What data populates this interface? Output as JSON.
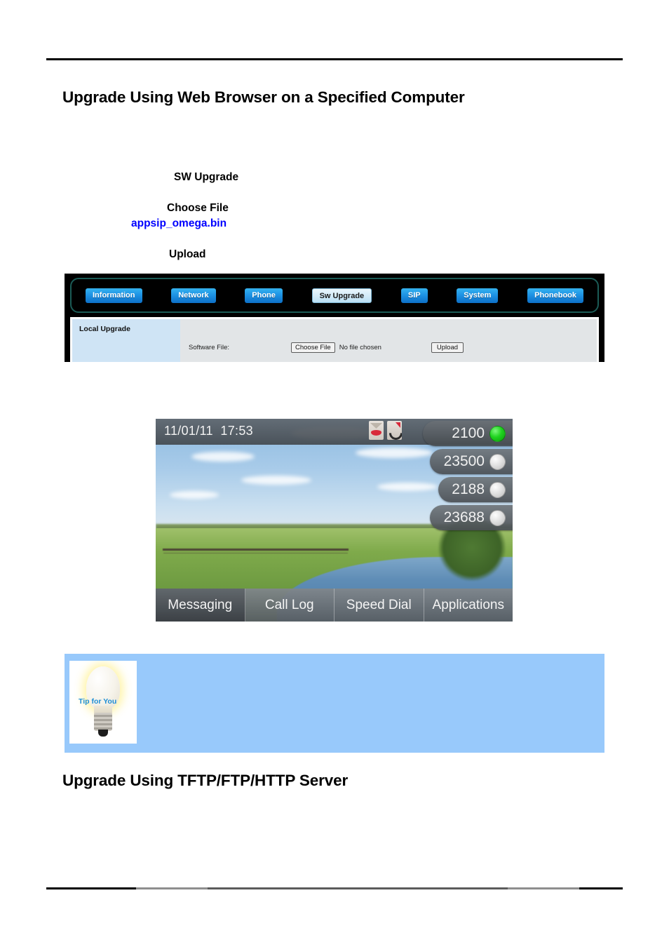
{
  "document": {
    "headings": {
      "web_browser": "Upgrade Using Web Browser on a Specified Computer",
      "tftp_server": "Upgrade Using TFTP/FTP/HTTP Server"
    },
    "captions": {
      "sw_upgrade": "SW Upgrade",
      "choose_file": "Choose File",
      "file_name": "appsip_omega.bin",
      "upload": "Upload"
    }
  },
  "web_ui": {
    "tabs": [
      {
        "label": "Information",
        "active": false
      },
      {
        "label": "Network",
        "active": false
      },
      {
        "label": "Phone",
        "active": false
      },
      {
        "label": "Sw Upgrade",
        "active": true
      },
      {
        "label": "SIP",
        "active": false
      },
      {
        "label": "System",
        "active": false
      },
      {
        "label": "Phonebook",
        "active": false
      }
    ],
    "sidebar": {
      "section_label": "Local Upgrade"
    },
    "form": {
      "field_label": "Software File:",
      "choose_file_button": "Choose File",
      "file_status": "No file chosen",
      "upload_button": "Upload"
    },
    "colors": {
      "tab_active_bg": "#cfe9f8",
      "tab_inactive_bg": "#1e93e4",
      "sidebar_bg": "#cfe4f5",
      "panel_bg": "#e2e5e7",
      "frame_bg": "#000000"
    }
  },
  "phone_screen": {
    "status_bar": {
      "date": "11/01/11",
      "time": "17:53",
      "icons": [
        {
          "name": "voicemail-icon"
        },
        {
          "name": "missed-call-icon"
        }
      ]
    },
    "line_keys": [
      {
        "label": "2100",
        "led": "green"
      },
      {
        "label": "23500",
        "led": "gray"
      },
      {
        "label": "2188",
        "led": "gray"
      },
      {
        "label": "23688",
        "led": "gray"
      }
    ],
    "soft_keys": [
      "Messaging",
      "Call Log",
      "Speed Dial",
      "Applications"
    ],
    "colors": {
      "led_active": "#1fd31f",
      "led_idle": "#e2e2e2",
      "bar_bg": "#606770"
    }
  },
  "tip_box": {
    "label": "Tip for You",
    "background": "#98c9fb"
  }
}
